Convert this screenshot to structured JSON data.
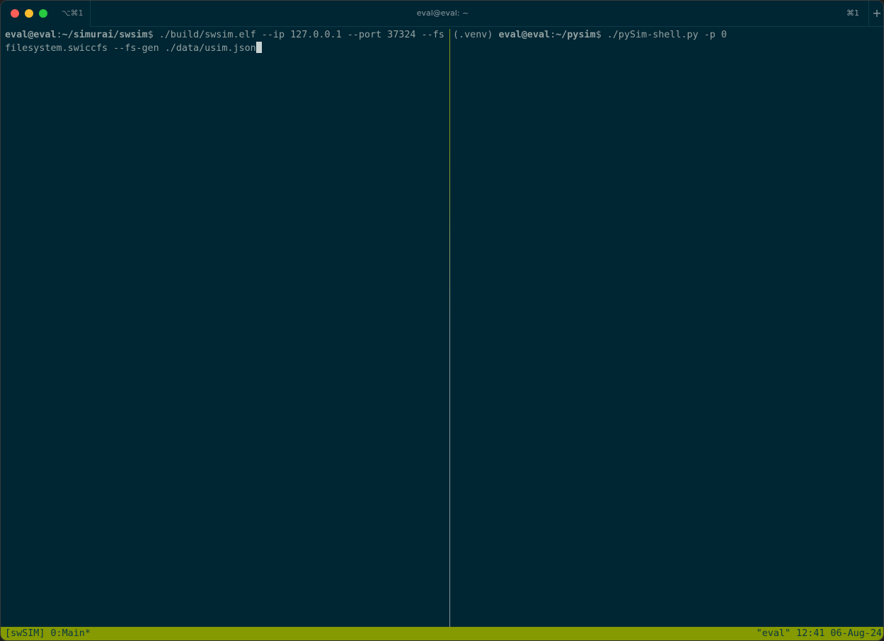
{
  "window": {
    "title": "eval@eval: ~",
    "tab_shortcut_left": "⌥⌘1",
    "tab_shortcut_right": "⌘1",
    "add_tab_label": "+"
  },
  "left_pane": {
    "prompt_user": "eval@eval",
    "prompt_sep": ":",
    "prompt_path": "~/simurai/swsim",
    "prompt_symbol": "$",
    "command_line1": " ./build/swsim.elf --ip 127.0.0.1 --port 37324 --fs",
    "command_line2": "filesystem.swiccfs --fs-gen ./data/usim.json"
  },
  "right_pane": {
    "venv": "(.venv) ",
    "prompt_user": "eval@eval",
    "prompt_sep": ":",
    "prompt_path": "~/pysim",
    "prompt_symbol": "$",
    "command": " ./pySim-shell.py -p 0"
  },
  "status": {
    "left": "[swSIM] 0:Main*",
    "right": "\"eval\" 12:41 06-Aug-24"
  },
  "colors": {
    "background": "#002633",
    "status_bar": "#859900",
    "text": "#93a1a1"
  }
}
